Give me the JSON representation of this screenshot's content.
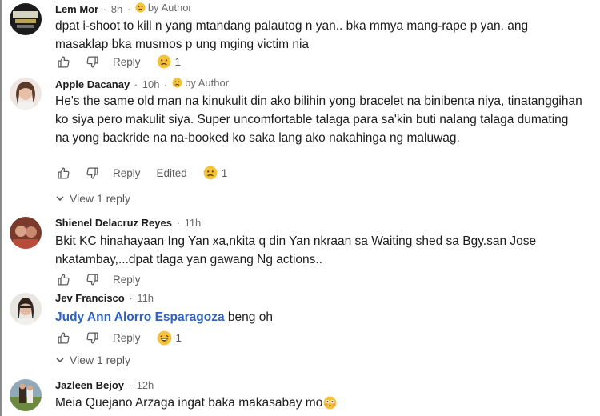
{
  "comments": [
    {
      "author": "Lem Mor",
      "time": "8h",
      "by_author_label": "by Author",
      "text": "dpat i-shoot to kill n yang mtandang palautog n yan.. bka mmya mang-rape p yan. ang masaklap bka musmos p ung mging victim nia",
      "reply_label": "Reply",
      "reaction_count": "1",
      "reaction_icon": "sad-face-icon"
    },
    {
      "author": "Apple Dacanay",
      "time": "10h",
      "by_author_label": "by Author",
      "text": "He's the same old man na kinukulit din ako bilihin yong bracelet na binibenta niya, tinatanggihan ko siya pero makulit siya. Super uncomfortable talaga para sa'kin buti nalang talaga dumating na yong backride na na-booked ko saka lang ako nakahinga ng maluwag.",
      "reply_label": "Reply",
      "edited_label": "Edited",
      "reaction_count": "1",
      "reaction_icon": "sad-face-icon",
      "view_replies": "View 1 reply"
    },
    {
      "author": "Shienel Delacruz Reyes",
      "time": "11h",
      "text": "Bkit KC hinahayaan Ing Yan xa,nkita q din Yan nkraan sa Waiting shed sa Bgy.san Jose nkatambay,...dpat tlaga yan gawang Ng actions..",
      "reply_label": "Reply"
    },
    {
      "author": "Jev Francisco",
      "time": "11h",
      "mention": "Judy Ann Alorro Esparagoza",
      "text": "beng oh",
      "reply_label": "Reply",
      "reaction_count": "1",
      "reaction_icon": "laughing-face-icon",
      "view_replies": "View 1 reply"
    },
    {
      "author": "Jazleen Bejoy",
      "time": "12h",
      "text": "Meia Quejano Arzaga ingat baka makasabay mo",
      "text_emoji": "flushed-face-icon"
    }
  ],
  "meta_separator": "·",
  "colors": {
    "mention": "#2b62c6",
    "secondary_text": "#6b6b6b",
    "primary_text": "#1c1c1c",
    "emoji_yellow": "#f5c33b"
  }
}
